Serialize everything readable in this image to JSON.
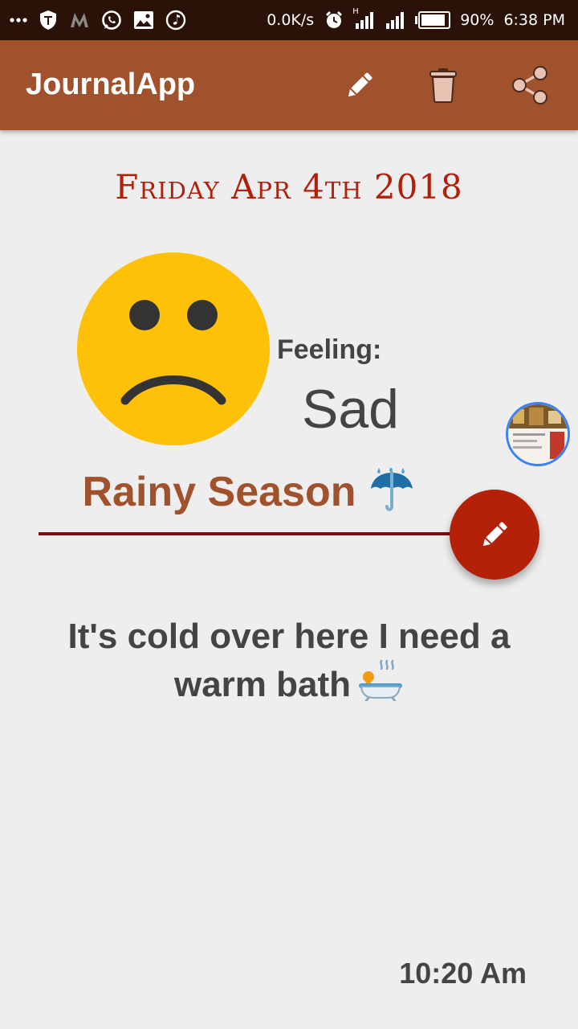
{
  "status_bar": {
    "speed": "0.0K/s",
    "network_type": "H",
    "battery_percent": "90%",
    "battery_level": 0.9,
    "clock": "6:38 PM",
    "left_icons": [
      "more-dots-icon",
      "shield-icon",
      "m-logo-icon",
      "whatsapp-icon",
      "image-icon",
      "music-note-icon"
    ]
  },
  "app_bar": {
    "title": "JournalApp",
    "actions": [
      "edit-icon",
      "delete-icon",
      "share-icon"
    ]
  },
  "entry": {
    "date": "Friday Apr 4th 2018",
    "mood_icon": "sad-face-icon",
    "feeling_label": "Feeling:",
    "feeling_value": "Sad",
    "title": "Rainy Season",
    "title_emoji": "umbrella-rain-icon",
    "body": "It's cold over here I need a warm bath",
    "body_emoji": "bath-icon",
    "time": "10:20 Am"
  },
  "colors": {
    "status_bar": "#2a1208",
    "app_bar": "#a0522d",
    "date": "#b0200c",
    "title": "#a0522d",
    "divider": "#7b0c0c",
    "fab": "#b52008",
    "face": "#ffc107",
    "text": "#444444",
    "background": "#eeeeee"
  }
}
